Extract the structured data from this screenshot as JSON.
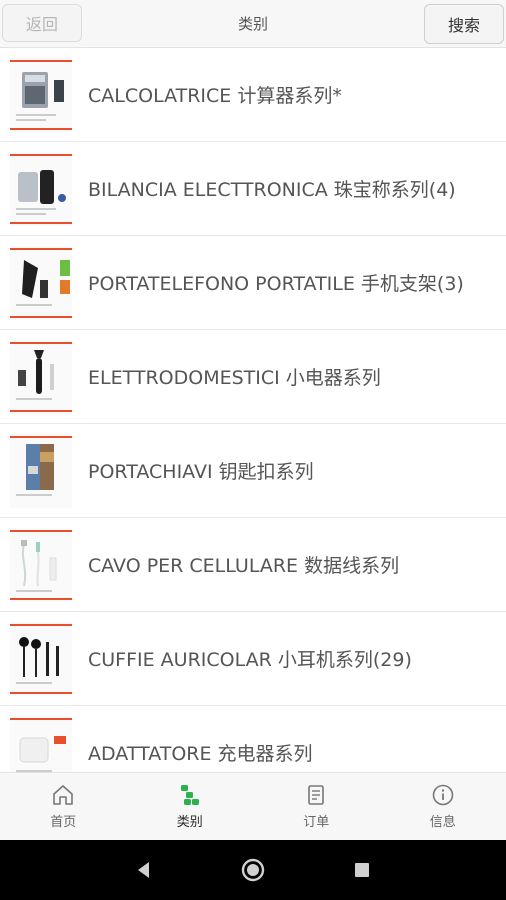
{
  "header": {
    "back_label": "返回",
    "title": "类别",
    "search_label": "搜索"
  },
  "categories": [
    {
      "label": "CALCOLATRICE 计算器系列*"
    },
    {
      "label": "BILANCIA ELECTTRONICA  珠宝称系列(4)"
    },
    {
      "label": "PORTATELEFONO PORTATILE 手机支架(3)"
    },
    {
      "label": "ELETTRODOMESTICI 小电器系列"
    },
    {
      "label": "PORTACHIAVI 钥匙扣系列"
    },
    {
      "label": "CAVO PER CELLULARE 数据线系列"
    },
    {
      "label": "CUFFIE AURICOLAR 小耳机系列(29)"
    },
    {
      "label": "ADATTATORE 充电器系列"
    }
  ],
  "tabs": [
    {
      "label": "首页",
      "icon": "home-icon"
    },
    {
      "label": "类别",
      "icon": "category-icon",
      "active": true
    },
    {
      "label": "订单",
      "icon": "order-icon"
    },
    {
      "label": "信息",
      "icon": "info-icon"
    }
  ],
  "colors": {
    "accent": "#2bb24c",
    "thumb_accent": "#e8502b"
  }
}
